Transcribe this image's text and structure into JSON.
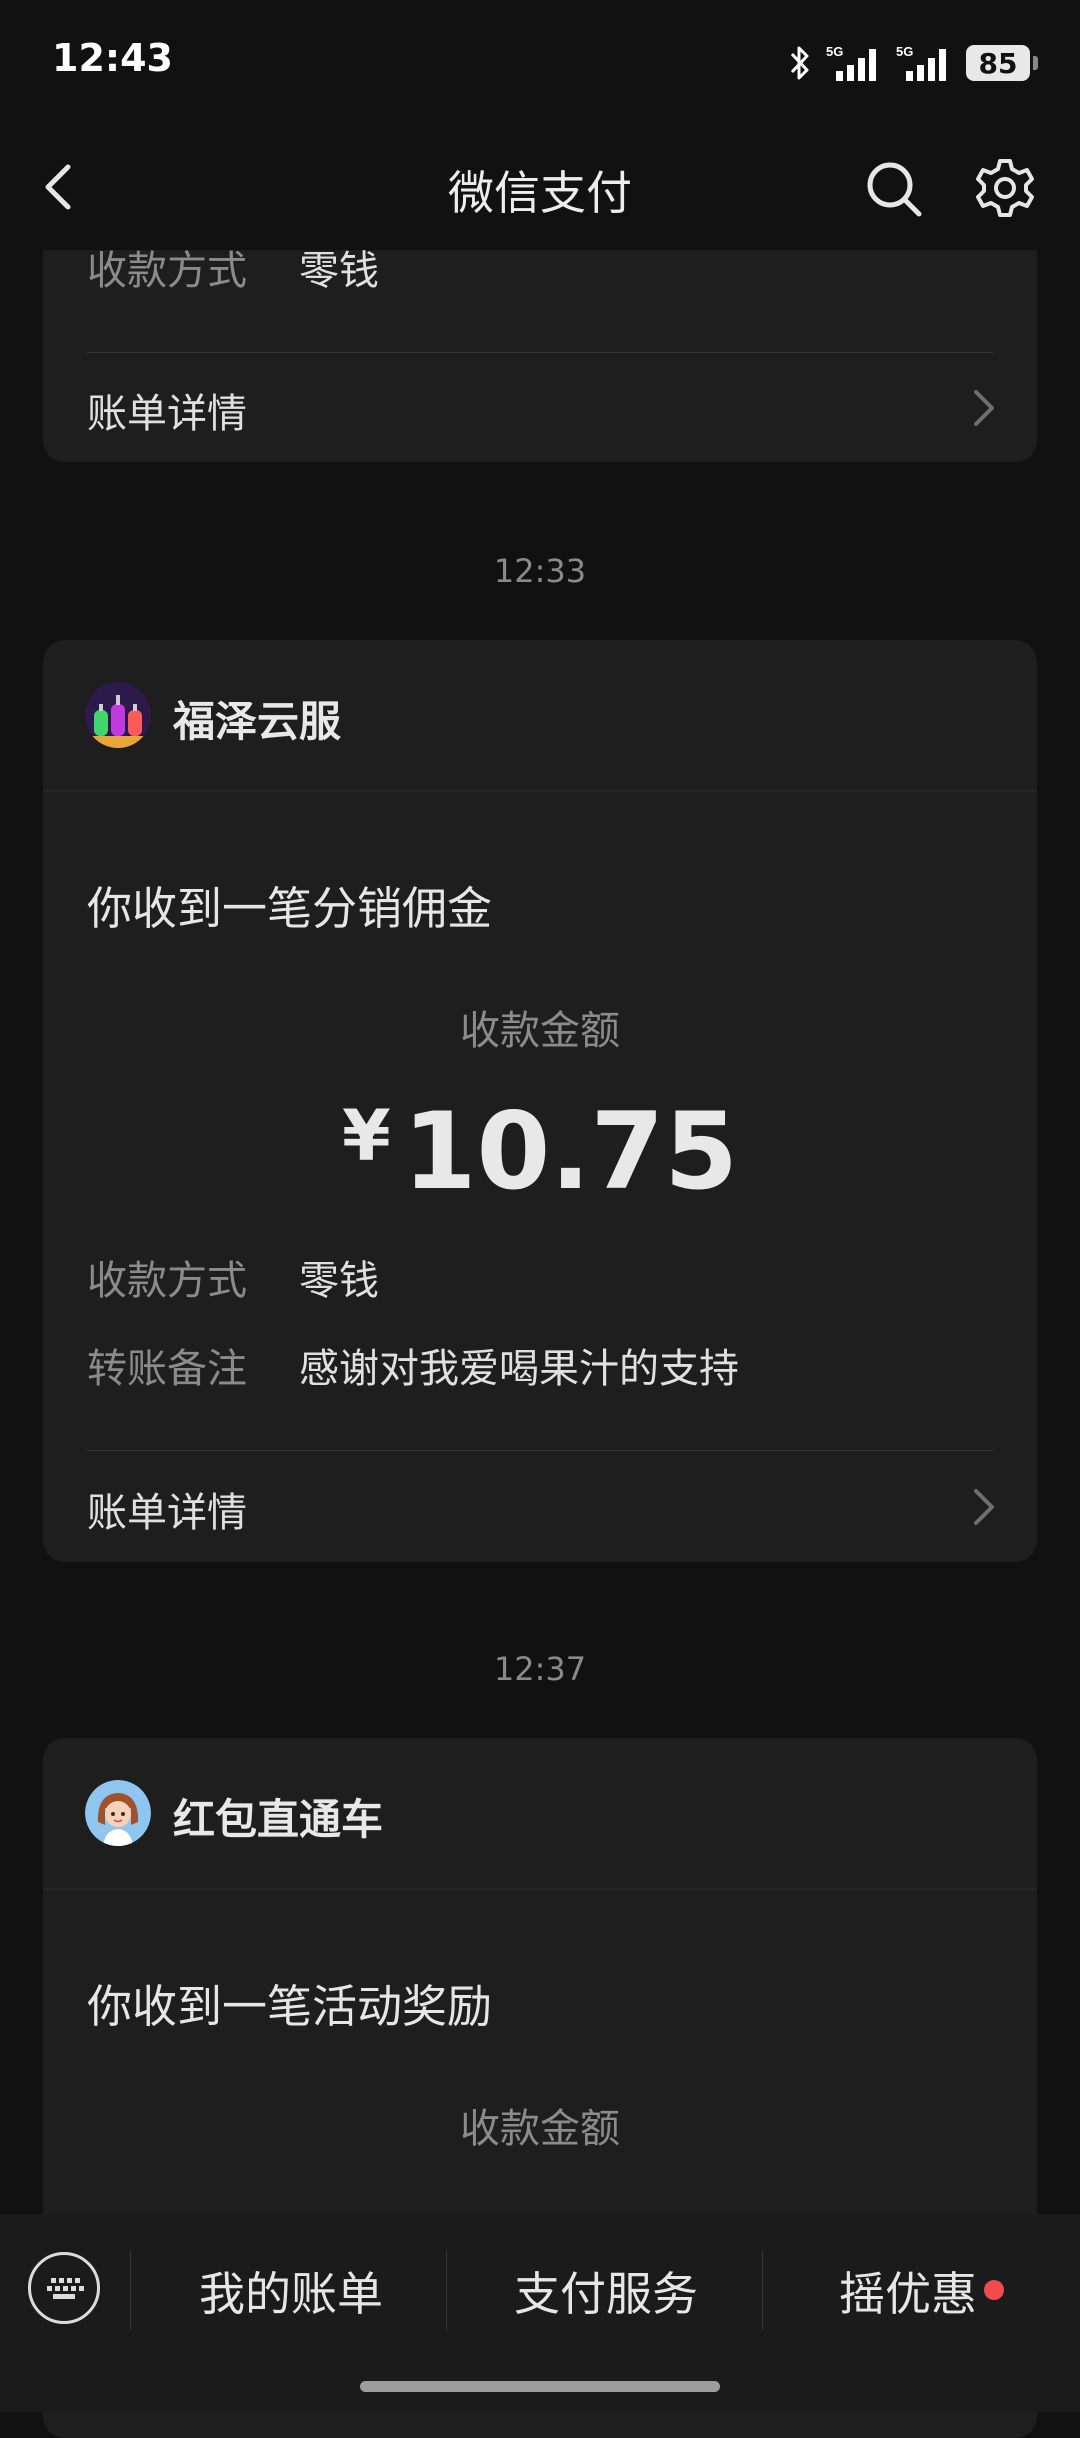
{
  "status": {
    "time": "12:43",
    "battery": "85",
    "network1": "5G",
    "network2": "5G"
  },
  "nav": {
    "title": "微信支付"
  },
  "card_top": {
    "method_label": "收款方式",
    "method_value": "零钱",
    "detail_label": "账单详情"
  },
  "timestamps": [
    "12:33",
    "12:37"
  ],
  "card1": {
    "merchant": "福泽云服",
    "headline": "你收到一笔分销佣金",
    "amount_label": "收款金额",
    "currency": "¥",
    "amount": "10.75",
    "method_label": "收款方式",
    "method_value": "零钱",
    "note_label": "转账备注",
    "note_value": "感谢对我爱喝果汁的支持",
    "detail_label": "账单详情"
  },
  "card2": {
    "merchant": "红包直通车",
    "headline": "你收到一笔活动奖励",
    "amount_label": "收款金额"
  },
  "bottom_bar": {
    "items": [
      "我的账单",
      "支付服务",
      "摇优惠"
    ],
    "badge_color": "#ef4b4b"
  }
}
